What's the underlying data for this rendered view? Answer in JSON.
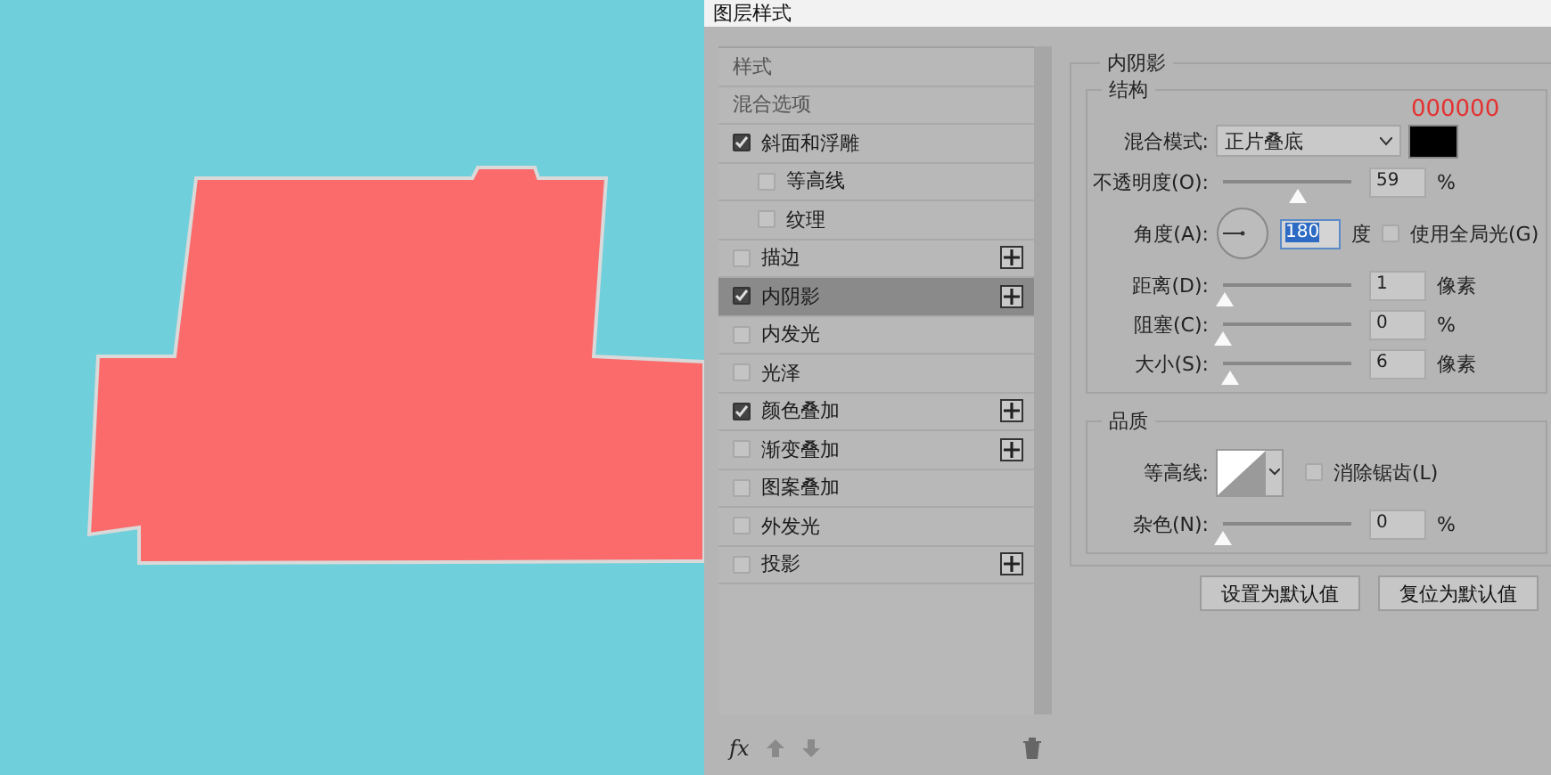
{
  "window": {
    "title": "图层样式"
  },
  "styles": [
    {
      "label": "样式",
      "kind": "header",
      "selected": false
    },
    {
      "label": "混合选项",
      "kind": "header",
      "selected": false
    },
    {
      "label": "斜面和浮雕",
      "kind": "effect",
      "checked": true,
      "selected": false,
      "add_button": false,
      "children": [
        {
          "label": "等高线",
          "kind": "effect",
          "checked": false,
          "selected": false,
          "add_button": false
        },
        {
          "label": "纹理",
          "kind": "effect",
          "checked": false,
          "selected": false,
          "add_button": false
        }
      ]
    },
    {
      "label": "描边",
      "kind": "effect",
      "checked": false,
      "selected": false,
      "add_button": true
    },
    {
      "label": "内阴影",
      "kind": "effect",
      "checked": true,
      "selected": true,
      "add_button": true
    },
    {
      "label": "内发光",
      "kind": "effect",
      "checked": false,
      "selected": false,
      "add_button": false
    },
    {
      "label": "光泽",
      "kind": "effect",
      "checked": false,
      "selected": false,
      "add_button": false
    },
    {
      "label": "颜色叠加",
      "kind": "effect",
      "checked": true,
      "selected": false,
      "add_button": true
    },
    {
      "label": "渐变叠加",
      "kind": "effect",
      "checked": false,
      "selected": false,
      "add_button": true
    },
    {
      "label": "图案叠加",
      "kind": "effect",
      "checked": false,
      "selected": false,
      "add_button": false
    },
    {
      "label": "外发光",
      "kind": "effect",
      "checked": false,
      "selected": false,
      "add_button": false
    },
    {
      "label": "投影",
      "kind": "effect",
      "checked": false,
      "selected": false,
      "add_button": true
    }
  ],
  "list_toolbar": {
    "fx": "fx"
  },
  "effect_panel": {
    "title": "内阴影",
    "structure": {
      "title": "结构",
      "color_code": "000000",
      "blend_mode": {
        "label": "混合模式:",
        "value": "正片叠底"
      },
      "rows": [
        {
          "kind": "slider",
          "label": "不透明度(O):",
          "value": "59",
          "unit": "%",
          "level": 0.59
        },
        {
          "kind": "angle",
          "label": "角度(A):",
          "value": "180",
          "unit": "度",
          "global_light": {
            "label": "使用全局光(G)",
            "checked": false
          }
        },
        {
          "kind": "slider",
          "label": "距离(D):",
          "value": "1",
          "unit": "像素",
          "level": 0.02
        },
        {
          "kind": "slider",
          "label": "阻塞(C):",
          "value": "0",
          "unit": "%",
          "level": 0
        },
        {
          "kind": "slider",
          "label": "大小(S):",
          "value": "6",
          "unit": "像素",
          "level": 0.05
        }
      ]
    },
    "quality": {
      "title": "品质",
      "contour_label": "等高线:",
      "anti_alias": {
        "label": "消除锯齿(L)",
        "checked": false
      },
      "noise": {
        "kind": "slider",
        "label": "杂色(N):",
        "value": "0",
        "unit": "%",
        "level": 0
      }
    }
  },
  "buttons": [
    "设置为默认值",
    "复位为默认值"
  ]
}
